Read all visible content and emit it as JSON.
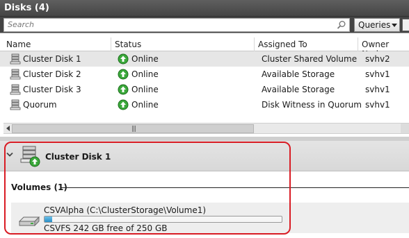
{
  "window": {
    "title": "Disks (4)"
  },
  "search": {
    "placeholder": "Search"
  },
  "toolbar": {
    "queries_label": "Queries"
  },
  "table": {
    "columns": [
      "Name",
      "Status",
      "Assigned To",
      "Owner Node"
    ],
    "rows": [
      {
        "name": "Cluster Disk 1",
        "status": "Online",
        "assigned_to": "Cluster Shared Volume",
        "owner_node": "svhv2"
      },
      {
        "name": "Cluster Disk 2",
        "status": "Online",
        "assigned_to": "Available Storage",
        "owner_node": "svhv1"
      },
      {
        "name": "Cluster Disk 3",
        "status": "Online",
        "assigned_to": "Available Storage",
        "owner_node": "svhv1"
      },
      {
        "name": "Quorum",
        "status": "Online",
        "assigned_to": "Disk Witness in Quorum",
        "owner_node": "svhv1"
      }
    ]
  },
  "detail": {
    "title": "Cluster Disk 1",
    "volumes_heading": "Volumes (1)",
    "volume": {
      "name": "CSVAlpha (C:\\ClusterStorage\\Volume1)",
      "info": "CSVFS 242 GB free of 250 GB",
      "used_fraction": 0.032
    }
  },
  "colors": {
    "highlight": "#d91c24",
    "online_green": "#3aa83a",
    "bar_fill": "#2a8fc7"
  }
}
